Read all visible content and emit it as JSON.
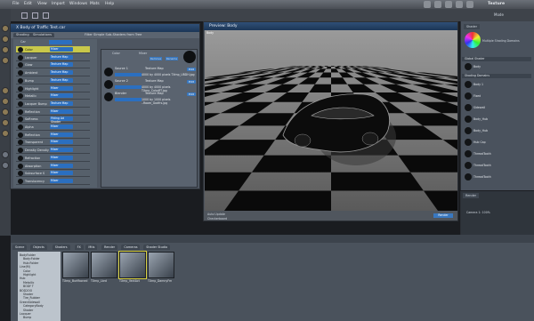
{
  "menu": {
    "file": "File",
    "edit": "Edit",
    "view": "View",
    "import": "Import",
    "windows": "Windows",
    "mats": "Mats",
    "help": "Help"
  },
  "app_title": "Texture",
  "mode": "Mode",
  "shader_window": {
    "title": "X Body of Traffic Test.car",
    "tabs": [
      "Shading",
      "Simulations"
    ],
    "filter": "Filter Simple Sub-Shaders from Tree",
    "root": "Car",
    "rows": [
      {
        "label": "Color",
        "value": "Mixer"
      },
      {
        "label": "Lacquer",
        "value": "Texture Map"
      },
      {
        "label": "Glow",
        "value": "Texture Map"
      },
      {
        "label": "Ambient",
        "value": "Texture Map"
      },
      {
        "label": "Bump",
        "value": "Texture Map"
      },
      {
        "label": "Highlight",
        "value": "Mixer"
      },
      {
        "label": "Metallic",
        "value": "Mixer"
      },
      {
        "label": "Lacquer Bump",
        "value": "Texture Map"
      },
      {
        "label": "Reflection",
        "value": "Mixer"
      },
      {
        "label": "Softness",
        "value": "Fitting Ad Shader"
      },
      {
        "label": "Alpha",
        "value": "Mixer"
      },
      {
        "label": "Reflection",
        "value": "Mixer"
      },
      {
        "label": "Transparent",
        "value": "Mixer"
      },
      {
        "label": "Density Density",
        "value": "Mixer"
      },
      {
        "label": "Refraction",
        "value": "Mixer"
      },
      {
        "label": "Absorption",
        "value": "Mixer"
      },
      {
        "label": "Subsurface S",
        "value": "Mixer"
      },
      {
        "label": "Translucency",
        "value": "Mixer"
      }
    ],
    "detail_header": "Color",
    "detail_mixer": "Mixer",
    "detail_buttons": [
      "Remove",
      "Rename"
    ],
    "sections": [
      {
        "title": "Source 1",
        "map": "Texture Map",
        "size": "4000 by 4000 pixels TXmp_UBDH.jpg"
      },
      {
        "title": "Source 2",
        "map": "Texture Map",
        "size": "4000 by 4000 pixels TXmp_ColorRT.jpg"
      },
      {
        "title": "Blender",
        "map": "Texture Map",
        "size": "1000 by 1000 pixels ..Room_Godfrs.jpg"
      }
    ],
    "edit": "Edit"
  },
  "preview": {
    "title": "Preview: Body",
    "label": "Body",
    "auto_update": "Auto Update",
    "checkerboard": "Checkerboard",
    "render": "Render"
  },
  "right_panel": {
    "shader_title": "Shader",
    "multiple": "Multiple Shading Domains",
    "global_shader": "Global Shader",
    "body_label": "Body",
    "shading_domains": "Shading Domains",
    "items": [
      "Body 1",
      "Fixed",
      "Sidewall",
      "Body_Hub",
      "Body_Hub",
      "Hub Cap",
      "ThreadTooth",
      "ThreadTooth",
      "ThreadTooth"
    ],
    "heads": [
      "Sidewall",
      "Body_Hub",
      "Hub Cap",
      "Threadtooth",
      "Threadtooth"
    ]
  },
  "camera": {
    "tab": "Render",
    "label": "Camera 1: 100%"
  },
  "bottom": {
    "tabs": [
      "Scene",
      "Objects",
      "Shaders",
      "FX",
      "Mtls",
      "Render",
      "Cameras",
      "Shader Studio"
    ],
    "tree": [
      "BodyFolder",
      "Body:Folder",
      "Hub:Folder",
      "Line(M)",
      "Color",
      "Highlight",
      "Hub",
      "Metallic",
      "BODY T",
      "BOD2OO",
      "Shader",
      "Tire_Rubber",
      "GreenSidewall",
      "CategoryBody",
      "Shader",
      "Lacquer",
      "Bump"
    ],
    "thumbs": [
      "TXmp_Burlfboned",
      "TXmp_Lbrd",
      "TXmp_VectAct",
      "TXmp_DamnyFm"
    ]
  },
  "colors": {
    "accent": "#2b6fc0",
    "selected": "#c8c84a",
    "title": "#1c3656"
  }
}
